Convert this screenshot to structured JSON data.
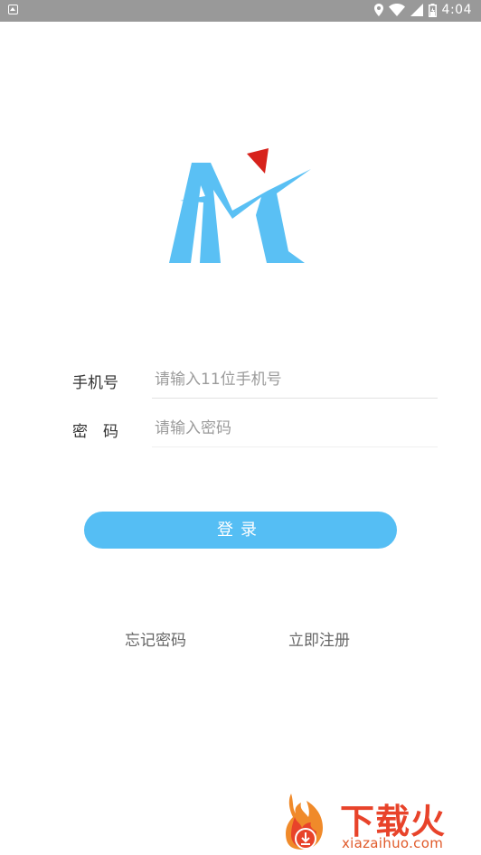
{
  "status_bar": {
    "time": "4:04",
    "icons": [
      "location-icon",
      "wifi-icon",
      "signal-icon",
      "battery-icon"
    ]
  },
  "logo": {
    "colors": {
      "primary": "#5ac0f4",
      "accent": "#d7221b"
    }
  },
  "form": {
    "phone_label": "手机号",
    "phone_placeholder": "请输入11位手机号",
    "phone_value": "",
    "password_label": "密　码",
    "password_placeholder": "请输入密码",
    "password_value": ""
  },
  "actions": {
    "login_label": "登录",
    "forgot_label": "忘记密码",
    "register_label": "立即注册"
  },
  "watermark": {
    "title": "下载火",
    "url": "xiazaihuo.com"
  },
  "colors": {
    "accent": "#55bef4",
    "status_bar": "#999999",
    "watermark": "#e8432a"
  }
}
